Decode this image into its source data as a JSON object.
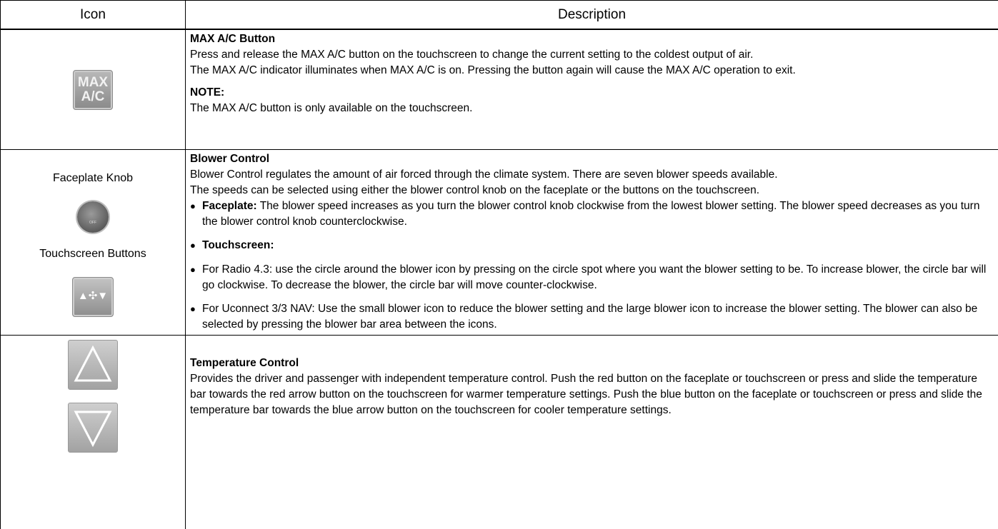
{
  "header": {
    "icon_col": "Icon",
    "desc_col": "Description"
  },
  "rows": [
    {
      "icon": {
        "name": "max-ac-icon",
        "line1": "MAX",
        "line2": "A/C"
      },
      "title": "MAX A/C Button",
      "paragraphs": [
        "Press and release the MAX A/C button on the touchscreen to change the current setting to the coldest output of air.",
        "The MAX A/C indicator illuminates when MAX A/C is on. Pressing the button again will cause the MAX A/C operation to exit."
      ],
      "note_title": "NOTE:",
      "note_text": "The MAX A/C button is only available on the touchscreen."
    },
    {
      "icon_labels": [
        "Faceplate Knob",
        "Touchscreen Buttons"
      ],
      "knob_text": "OFF",
      "blower_icon": "▲✣▼",
      "title": "Blower Control",
      "paragraphs": [
        "Blower Control regulates the amount of air forced through the climate system. There are seven blower speeds available.",
        "The speeds can be selected using either the blower control knob on the faceplate or the buttons on the touchscreen."
      ],
      "bullets": [
        {
          "label": "Faceplate:",
          "text": " The blower speed increases as you turn the blower control knob clockwise from the lowest blower setting. The blower speed decreases as you turn the blower control knob counterclockwise."
        },
        {
          "label": "Touchscreen:",
          "text": ""
        },
        {
          "label": "",
          "text": "For Radio 4.3: use the circle around the blower icon by pressing on the circle spot where you want the blower setting to be. To increase blower, the circle bar will go clockwise. To decrease the blower, the circle bar will move counter-clockwise."
        },
        {
          "label": "",
          "text": "For Uconnect 3/3 NAV: Use the small blower icon to reduce the blower setting and the large blower icon to increase the blower setting. The blower can also be selected by pressing the blower bar area between the icons."
        }
      ]
    },
    {
      "icons": [
        "temperature-up-icon",
        "temperature-down-icon"
      ],
      "title": "Temperature Control",
      "paragraphs": [
        "Provides the driver and passenger with independent temperature control. Push the red button on the faceplate or touchscreen or press and slide the temperature bar towards the red arrow button on the touchscreen for warmer temperature settings. Push the blue button on the faceplate or touchscreen or press and slide the temperature bar towards the blue arrow button on the touchscreen for cooler temperature settings."
      ]
    }
  ]
}
